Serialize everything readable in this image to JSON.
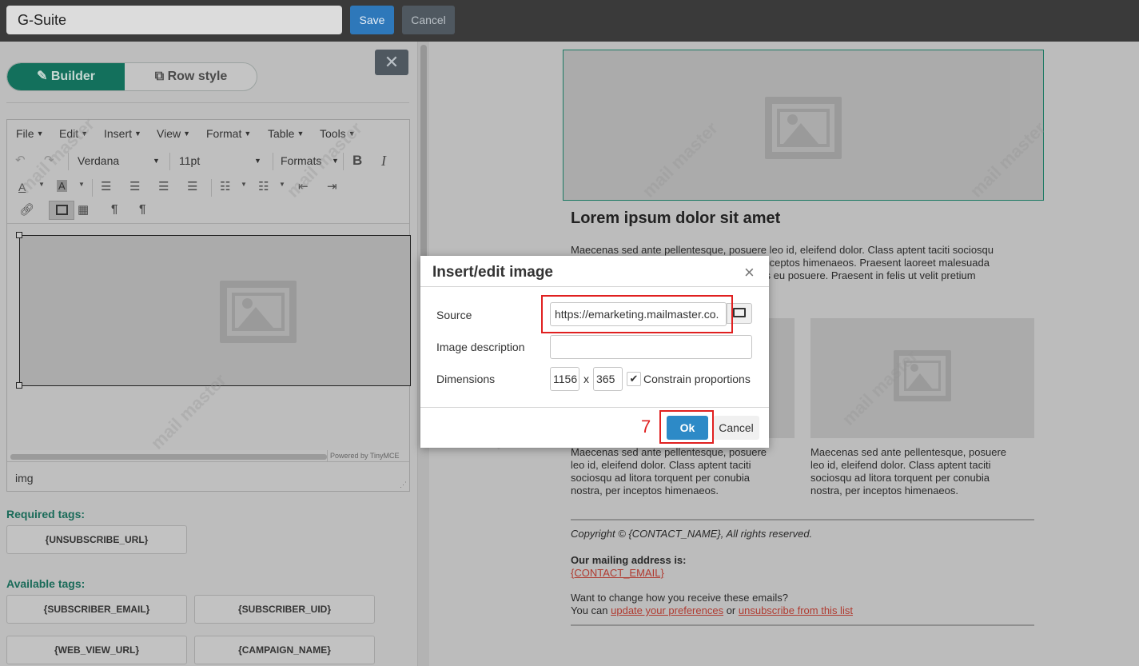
{
  "topbar": {
    "title_value": "G-Suite",
    "save_label": "Save",
    "cancel_label": "Cancel"
  },
  "left_panel": {
    "toggle": {
      "builder_label": "Builder",
      "row_style_label": "Row style"
    },
    "close_label": "✕",
    "editor": {
      "menu": [
        "File",
        "Edit",
        "Insert",
        "View",
        "Format",
        "Table",
        "Tools"
      ],
      "font_family": "Verdana",
      "font_size": "11pt",
      "formats_label": "Formats",
      "bold_label": "B",
      "italic_label": "I",
      "powered_by": "Powered by TinyMCE",
      "status_path": "img"
    },
    "required_tags_heading": "Required tags:",
    "required_tags": [
      "{UNSUBSCRIBE_URL}"
    ],
    "available_tags_heading": "Available tags:",
    "available_tags": [
      "{SUBSCRIBER_EMAIL}",
      "{SUBSCRIBER_UID}",
      "{WEB_VIEW_URL}",
      "{CAMPAIGN_NAME}"
    ]
  },
  "preview": {
    "heading": "Lorem ipsum dolor sit amet",
    "intro_lines": [
      "Maecenas sed ante pellentesque, posuere leo id, eleifend dolor. Class aptent taciti sociosqu",
      "ad litora torquent per conubia nostra, per inceptos himenaeos. Praesent laoreet malesuada",
      "cursus. Maecenas scelerisque congue eros eu posuere. Praesent in felis ut velit pretium"
    ],
    "col_text_lines": [
      "Maecenas sed ante pellentesque, posuere",
      "leo id, eleifend dolor. Class aptent taciti",
      "sociosqu ad litora torquent per conubia",
      "nostra, per inceptos himenaeos."
    ],
    "copyright": "Copyright © {CONTACT_NAME}, All rights reserved.",
    "mailing_label": "Our mailing address is:",
    "contact_email": "{CONTACT_EMAIL}",
    "change_line": "Want to change how you receive these emails?",
    "you_can": "You can",
    "update_link": "update your preferences",
    "or_text": "or",
    "unsubscribe_link": "unsubscribe from this list"
  },
  "dialog": {
    "title": "Insert/edit image",
    "close_label": "×",
    "source_label": "Source",
    "source_value": "https://emarketing.mailmaster.co.",
    "description_label": "Image description",
    "description_value": "",
    "dimensions_label": "Dimensions",
    "width_value": "1156",
    "dim_separator": "x",
    "height_value": "365",
    "constrain_label": "Constrain proportions",
    "constrain_checked": true,
    "ok_label": "Ok",
    "cancel_label": "Cancel"
  },
  "annotation": {
    "step_number": "7"
  },
  "watermark_text": "mail master",
  "colors": {
    "accent_green": "#13705c",
    "save_blue": "#2e78ba",
    "ok_blue": "#2d8ac7",
    "highlight_red": "#e02020",
    "link_red": "#b03a30"
  }
}
